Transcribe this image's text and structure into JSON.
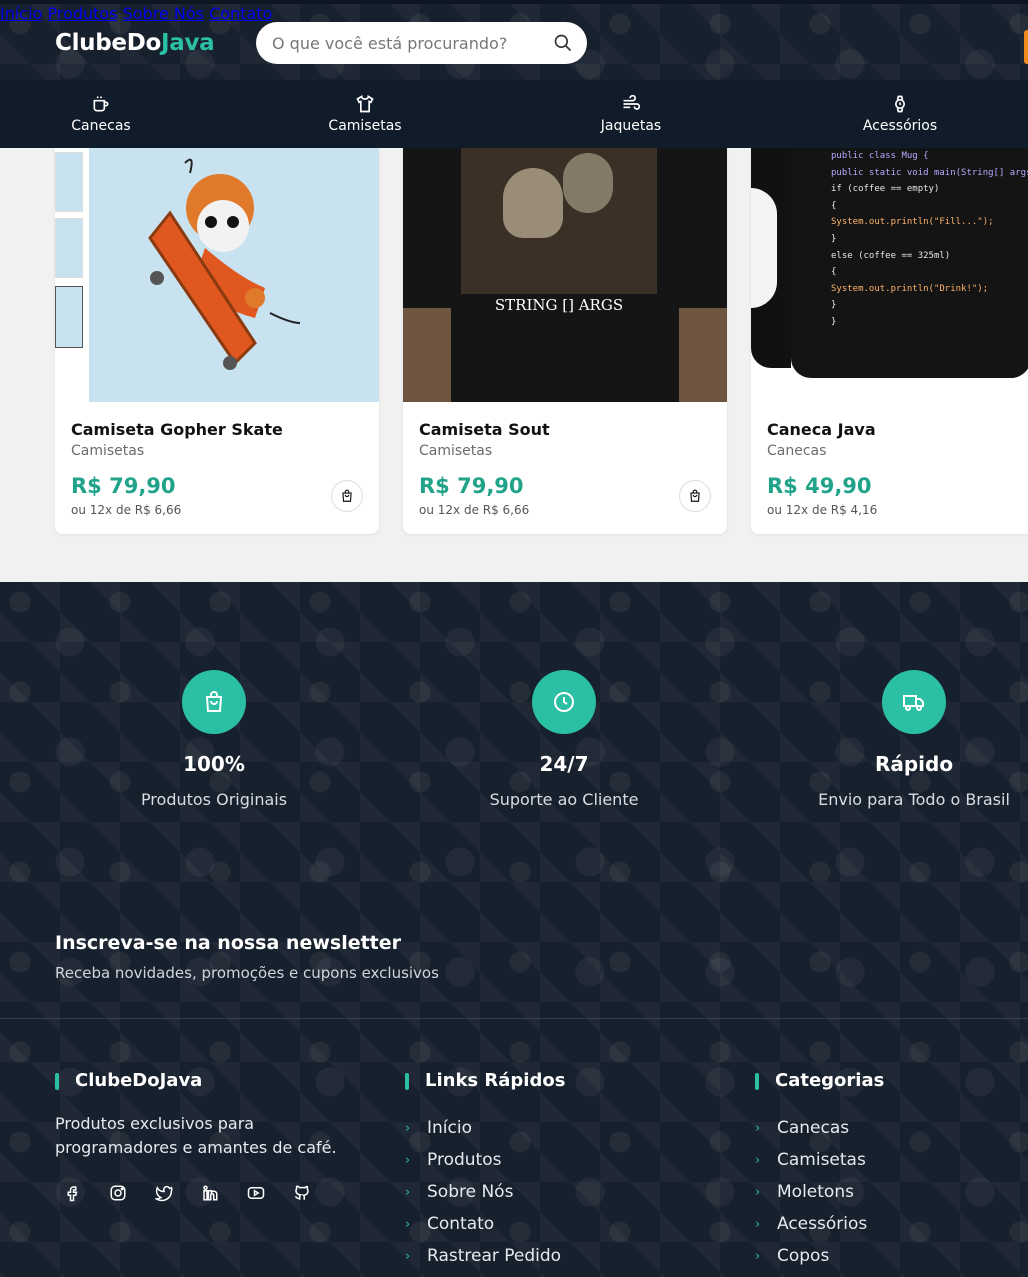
{
  "header": {
    "logo_main": "ClubeDo",
    "logo_accent": "Java",
    "search_placeholder": "O que você está procurando?",
    "nav": [
      "Início",
      "Produtos",
      "Sobre Nós",
      "Contato"
    ]
  },
  "categories": [
    "Canecas",
    "Camisetas",
    "Jaquetas",
    "Acessórios"
  ],
  "products": [
    {
      "name": "Camiseta Gopher Skate",
      "category": "Camisetas",
      "price": "R$ 79,90",
      "installments": "ou 12x de R$ 6,66"
    },
    {
      "name": "Camiseta Sout",
      "category": "Camisetas",
      "price": "R$ 79,90",
      "installments": "ou 12x de R$ 6,66",
      "shirt_print": "STRING [] ARGS"
    },
    {
      "name": "Caneca Java",
      "category": "Canecas",
      "price": "R$ 49,90",
      "installments": "ou 12x de R$ 4,16",
      "mug_code": [
        "public class Mug {",
        "public static void main(String[] args)",
        "if (coffee == empty)",
        "{",
        "System.out.println(\"Fill...\");",
        "}",
        "else (coffee == 325ml)",
        "{",
        "System.out.println(\"Drink!\");",
        "}",
        "}"
      ]
    }
  ],
  "features": [
    {
      "value": "100%",
      "label": "Produtos Originais",
      "icon": "shopping-bag-icon"
    },
    {
      "value": "24/7",
      "label": "Suporte ao Cliente",
      "icon": "clock-icon"
    },
    {
      "value": "Rápido",
      "label": "Envio para Todo o Brasil",
      "icon": "truck-icon"
    }
  ],
  "newsletter": {
    "title": "Inscreva-se na nossa newsletter",
    "subtitle": "Receba novidades, promoções e cupons exclusivos"
  },
  "footer": {
    "brand_title": "ClubeDoJava",
    "brand_text": "Produtos exclusivos para programadores e amantes de café.",
    "socials": [
      "facebook-icon",
      "instagram-icon",
      "twitter-icon",
      "linkedin-icon",
      "youtube-icon",
      "github-icon"
    ],
    "quick_links_title": "Links Rápidos",
    "quick_links": [
      "Início",
      "Produtos",
      "Sobre Nós",
      "Contato",
      "Rastrear Pedido"
    ],
    "categories_title": "Categorias",
    "categories": [
      "Canecas",
      "Camisetas",
      "Moletons",
      "Acessórios",
      "Copos"
    ]
  },
  "colors": {
    "accent": "#2bbfa3",
    "dark": "#17202d",
    "price": "#21a38a",
    "orange": "#f08a1d"
  }
}
